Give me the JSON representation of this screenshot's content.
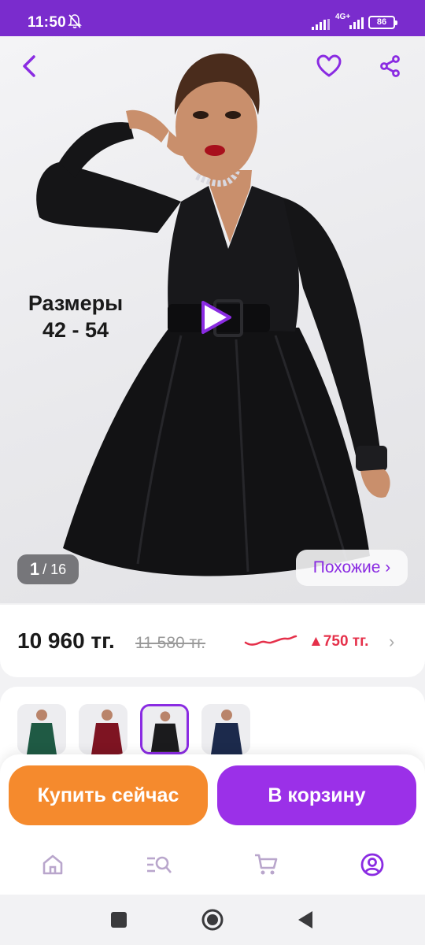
{
  "status_bar": {
    "time": "11:50",
    "network": "4G+",
    "battery": "86"
  },
  "product_image": {
    "overlay_text_line1": "Размеры",
    "overlay_text_line2": "42 - 54",
    "counter_current": "1",
    "counter_total": "/ 16",
    "similar_label": "Похожие ›"
  },
  "price": {
    "current": "10 960 тг.",
    "old": "11 580 тг.",
    "delta": "▲750 тг.",
    "chevron": "›"
  },
  "variants": {
    "colors": [
      "#1f5a44",
      "#7e1422",
      "#1b1b1d",
      "#1c2a4c"
    ],
    "selected_index": 2
  },
  "actions": {
    "buy_now": "Купить сейчас",
    "add_to_cart": "В корзину"
  },
  "icons": {
    "back": "back-arrow-icon",
    "favorite": "heart-icon",
    "share": "share-icon",
    "play": "play-icon",
    "home": "home-icon",
    "catalog": "catalog-search-icon",
    "cart": "cart-icon",
    "profile": "profile-icon"
  },
  "colors": {
    "brand_purple": "#7a2ccd",
    "buy_orange": "#f58a2d",
    "cart_purple": "#9b30e8",
    "price_up_red": "#e5304a"
  }
}
